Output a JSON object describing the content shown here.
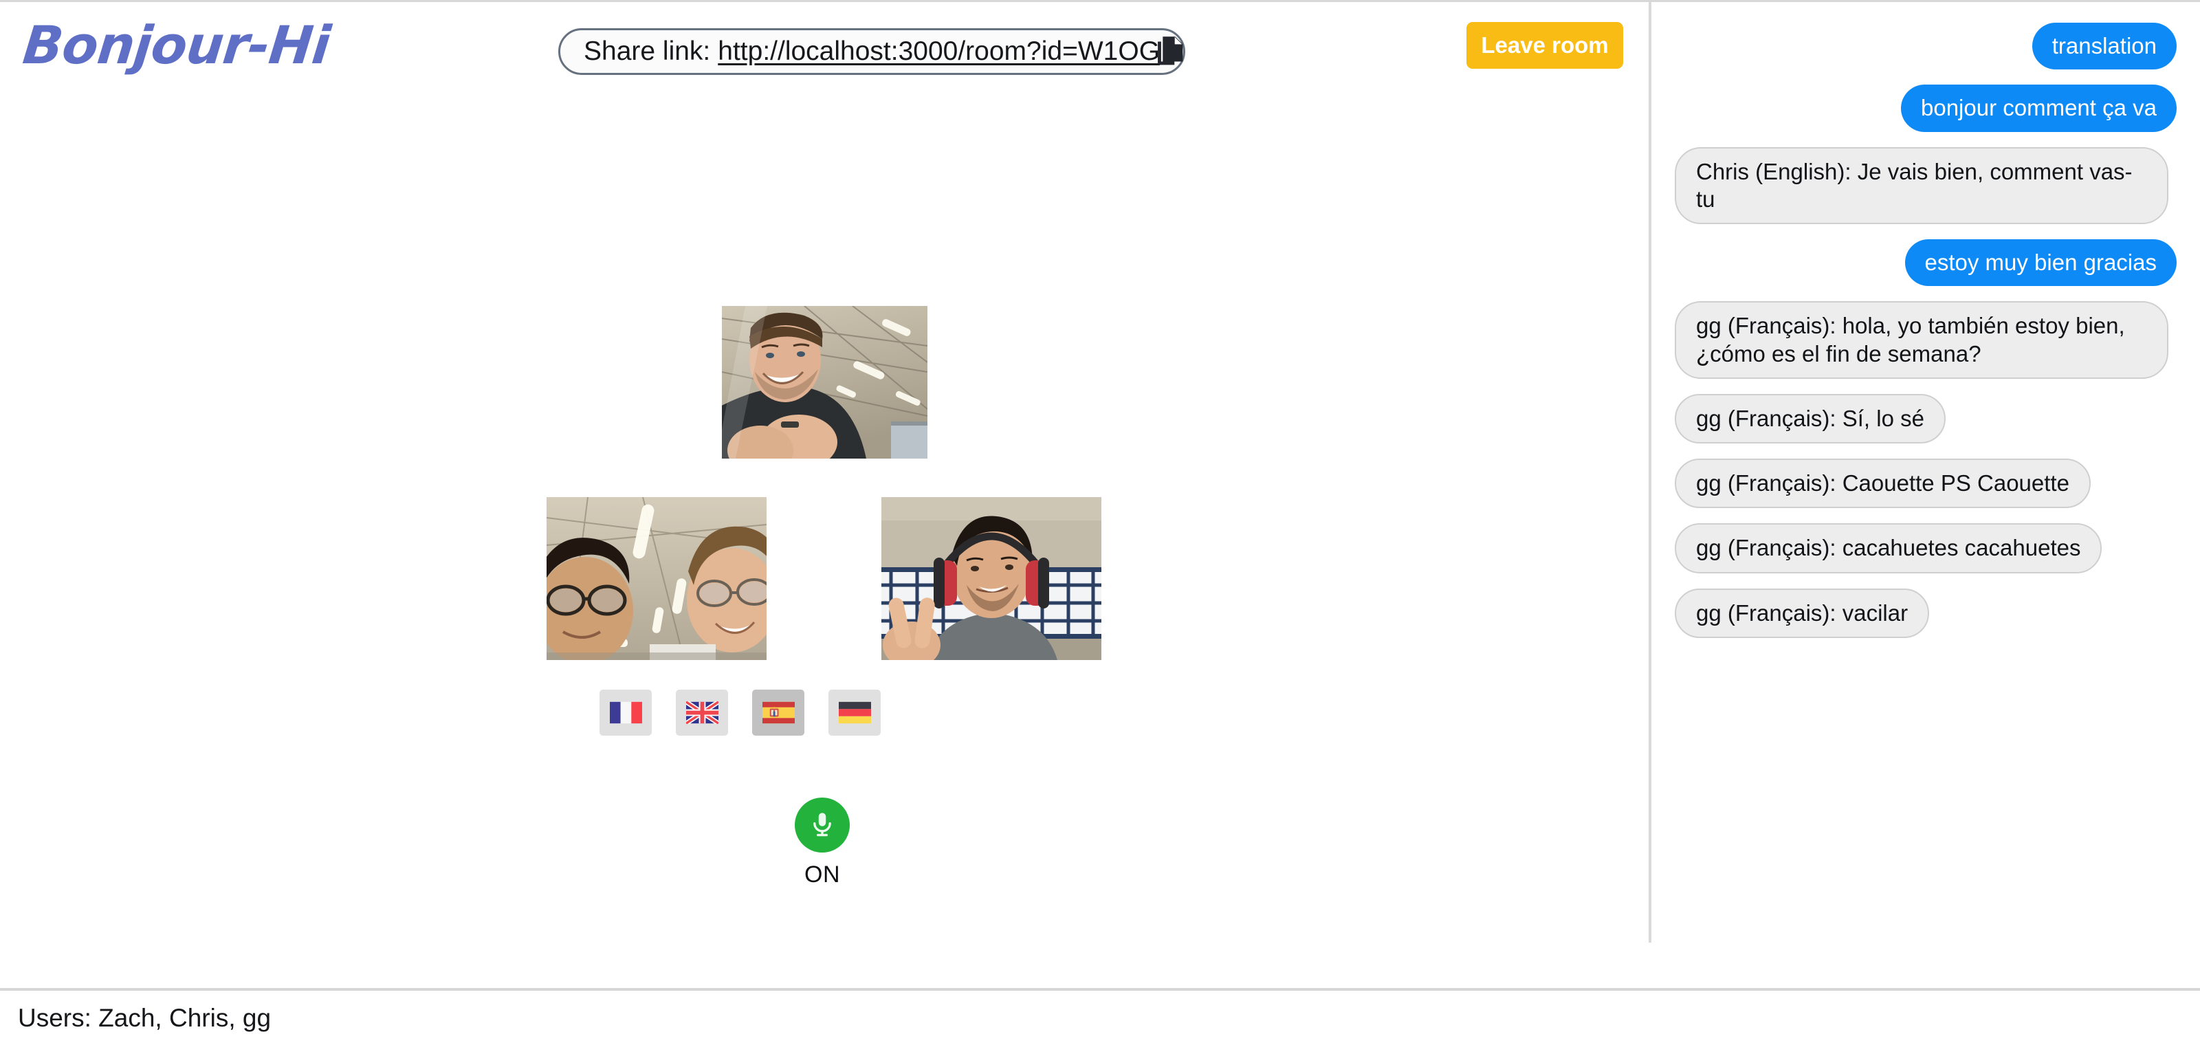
{
  "app": {
    "logo_text": "Bonjour-Hi",
    "logo_color": "#5f6fc6"
  },
  "header": {
    "share_link_label": "Share link:",
    "share_link_url": "http://localhost:3000/room?id=W1OG",
    "copy_icon": "copy-icon",
    "leave_room_label": "Leave room",
    "leave_room_color": "#f9bc15"
  },
  "video": {
    "tiles": [
      {
        "id": "top",
        "participant": "smiling-person-dark-hoodie"
      },
      {
        "id": "left",
        "participant": "two-people-with-glasses"
      },
      {
        "id": "right",
        "participant": "person-with-headphones-peace-sign"
      }
    ]
  },
  "languages": {
    "selected": "es",
    "options": [
      {
        "code": "fr",
        "name": "Français",
        "flag": "flag-france",
        "selected": false
      },
      {
        "code": "en",
        "name": "English",
        "flag": "flag-uk",
        "selected": false
      },
      {
        "code": "es",
        "name": "Español",
        "flag": "flag-spain",
        "selected": true
      },
      {
        "code": "de",
        "name": "Deutsch",
        "flag": "flag-germany",
        "selected": false
      }
    ]
  },
  "mic": {
    "icon": "microphone-icon",
    "status_label": "ON",
    "on_color": "#23b23c"
  },
  "chat": {
    "accent_outgoing": "#0e8af6",
    "accent_incoming": "#ededed",
    "messages": [
      {
        "direction": "outgoing",
        "text": "translation"
      },
      {
        "direction": "outgoing",
        "text": "bonjour comment ça va"
      },
      {
        "direction": "incoming",
        "text": "Chris (English): Je vais bien, comment vas-tu"
      },
      {
        "direction": "outgoing",
        "text": "estoy muy bien gracias"
      },
      {
        "direction": "incoming",
        "text": "gg (Français): hola, yo también estoy bien, ¿cómo es el fin de semana?"
      },
      {
        "direction": "incoming",
        "text": "gg (Français): Sí, lo sé"
      },
      {
        "direction": "incoming",
        "text": "gg (Français): Caouette PS Caouette"
      },
      {
        "direction": "incoming",
        "text": "gg (Français): cacahuetes cacahuetes"
      },
      {
        "direction": "incoming",
        "text": "gg (Français): vacilar"
      }
    ]
  },
  "footer": {
    "users_text": "Users: Zach, Chris, gg"
  }
}
